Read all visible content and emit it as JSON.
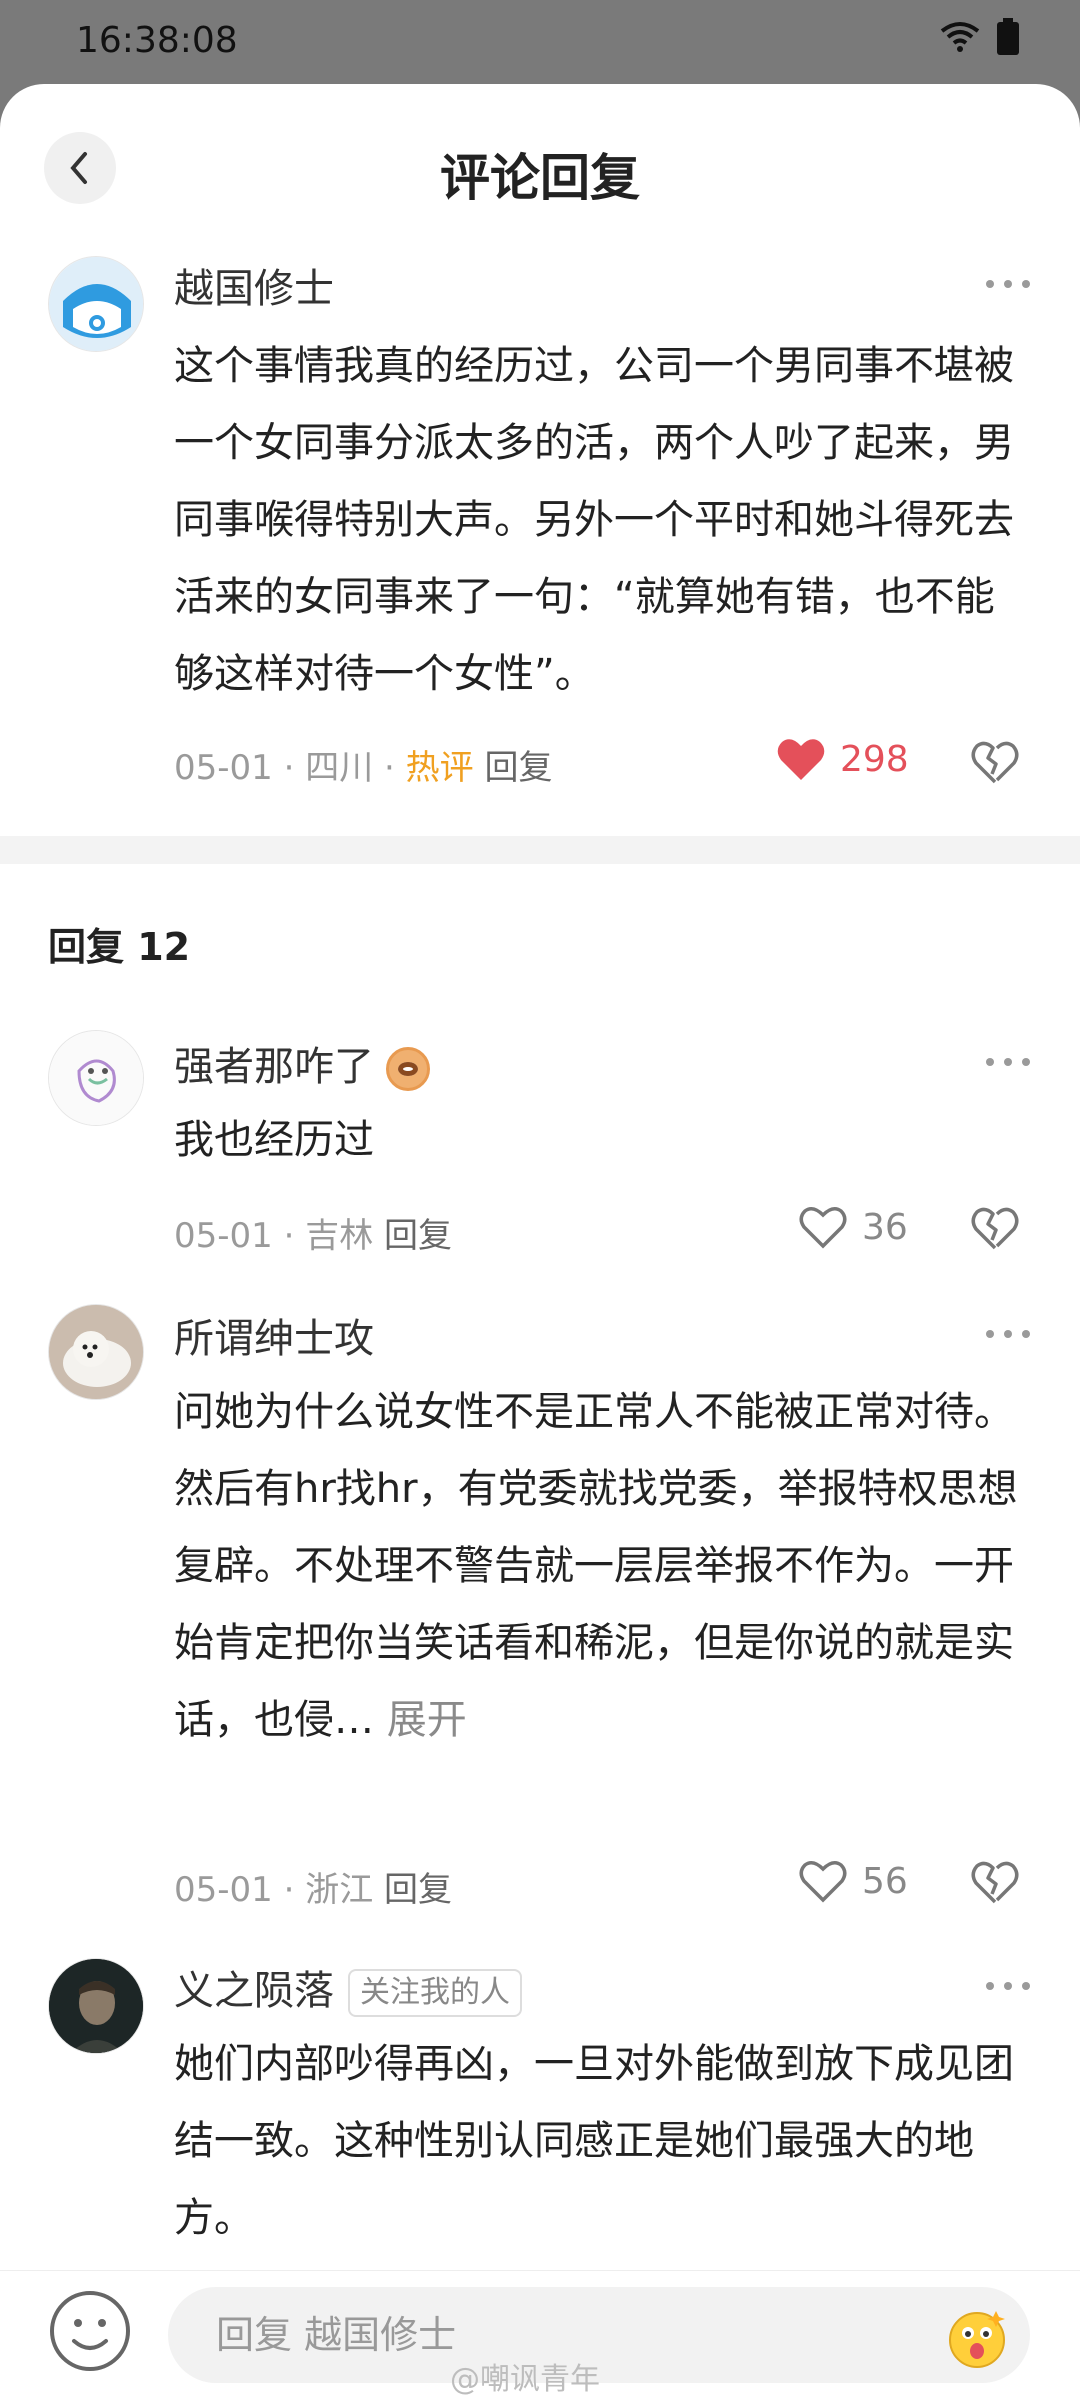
{
  "status": {
    "time": "16:38:08"
  },
  "header": {
    "title": "评论回复"
  },
  "main_comment": {
    "name": "越国修士",
    "text": "这个事情我真的经历过，公司一个男同事不堪被一个女同事分派太多的活，两个人吵了起来，男同事喉得特别大声。另外一个平时和她斗得死去活来的女同事来了一句：“就算她有错，也不能够这样对待一个女性”。",
    "date": "05-01",
    "location": "四川",
    "hot": "热评",
    "reply_label": "回复",
    "likes": "298"
  },
  "replies": {
    "header": "回复 12",
    "items": [
      {
        "name": "强者那咋了",
        "text": "我也经历过",
        "date": "05-01",
        "location": "吉林",
        "reply_label": "回复",
        "likes": "36"
      },
      {
        "name": "所谓绅士攻",
        "text": "问她为什么说女性不是正常人不能被正常对待。\n然后有hr找hr，有党委就找党委，举报特权思想复辟。不处理不警告就一层层举报不作为。一开始肯定把你当笑话看和稀泥，但是你说的就是实话，也侵…",
        "expand": "展开",
        "date": "05-01",
        "location": "浙江",
        "reply_label": "回复",
        "likes": "56"
      },
      {
        "name": "义之陨落",
        "tag": "关注我的人",
        "text": "她们内部吵得再凶，一旦对外能做到放下成见团结一致。这种性别认同感正是她们最强大的地方。"
      }
    ]
  },
  "footer": {
    "input_placeholder": "回复 越国修士",
    "watermark": "@嘲讽青年"
  },
  "colors": {
    "like_red": "#e4505a",
    "hot_orange": "#f0a020",
    "meta_gray": "#9a9a9a"
  },
  "icons": [
    "back-arrow-icon",
    "wifi-icon",
    "battery-icon",
    "more-dots-icon",
    "heart-icon",
    "broken-heart-icon",
    "smiley-icon",
    "sticker-icon",
    "eye-badge-icon"
  ]
}
